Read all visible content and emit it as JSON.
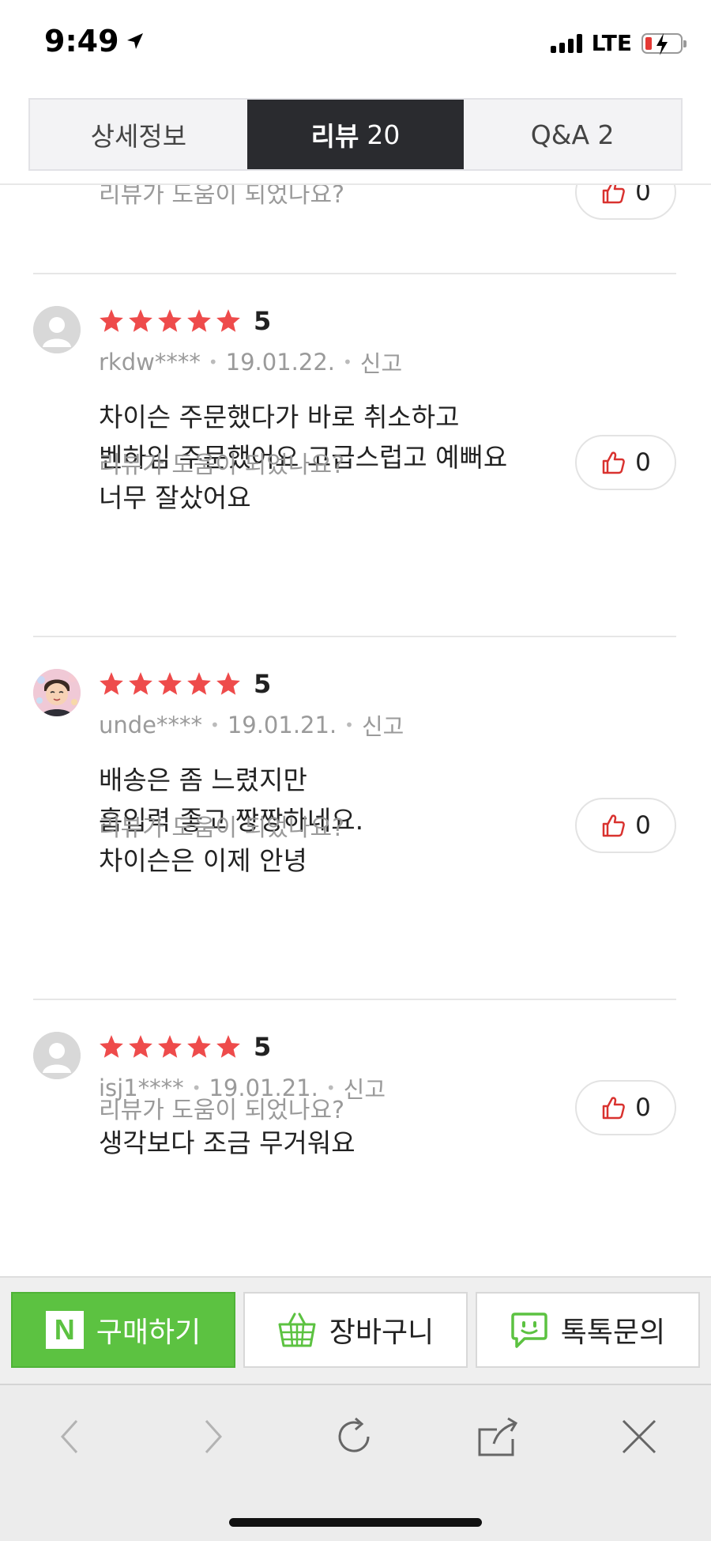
{
  "status_bar": {
    "time": "9:49",
    "network": "LTE"
  },
  "tabs": [
    {
      "label": "상세정보",
      "count": ""
    },
    {
      "label": "리뷰",
      "count": "20"
    },
    {
      "label": "Q&A 2",
      "count": ""
    }
  ],
  "helpful_prompt": "리뷰가 도움이 되었나요?",
  "top_partial": {
    "likes": "0"
  },
  "reviews": [
    {
      "rating": "5",
      "user": "rkdw****",
      "date": "19.01.22.",
      "report": "신고",
      "lines": [
        "차이슨 주문했다가 바로 취소하고",
        "벤하임 주문했어요 고급스럽고 예뻐요",
        "너무 잘샀어요"
      ],
      "likes": "0"
    },
    {
      "rating": "5",
      "user": "unde****",
      "date": "19.01.21.",
      "report": "신고",
      "lines": [
        "배송은 좀 느렸지만",
        "흡입력 좋고 짱짱하네요.",
        "차이슨은 이제 안녕"
      ],
      "likes": "0"
    },
    {
      "rating": "5",
      "user": "isj1****",
      "date": "19.01.21.",
      "report": "신고",
      "lines": [
        "생각보다 조금 무거워요"
      ],
      "likes": "0"
    }
  ],
  "actions": {
    "buy": "구매하기",
    "cart": "장바구니",
    "talk": "톡톡문의"
  },
  "colors": {
    "star": "#ee4b4b",
    "buy_green": "#5cc241",
    "tab_active": "#2a2b2f",
    "like_icon": "#d9322f"
  }
}
